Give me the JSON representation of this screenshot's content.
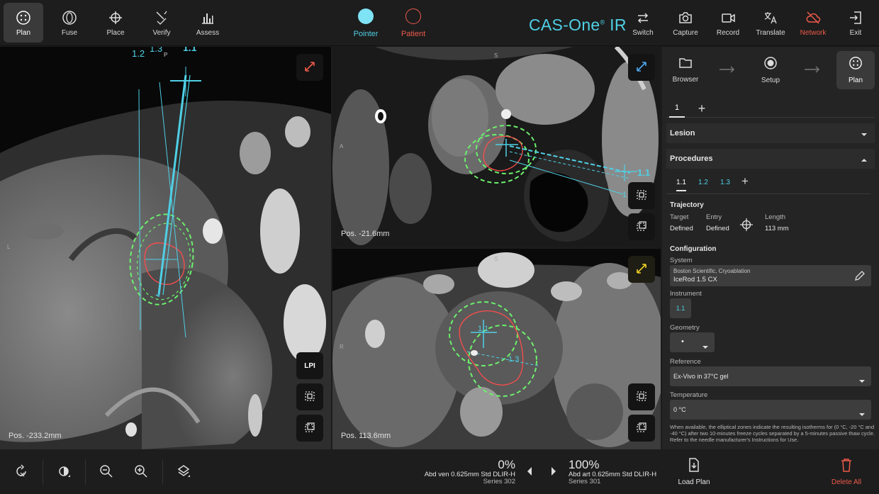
{
  "toolbar": {
    "left_tools": [
      {
        "label": "Plan",
        "icon": "plan-icon"
      },
      {
        "label": "Fuse",
        "icon": "fuse-icon"
      },
      {
        "label": "Place",
        "icon": "crosshair-icon"
      },
      {
        "label": "Verify",
        "icon": "verify-icon"
      },
      {
        "label": "Assess",
        "icon": "chart-icon"
      }
    ],
    "pointer_label": "Pointer",
    "patient_label": "Patient",
    "brand": "CAS-One",
    "brand_reg": "®",
    "brand_suffix": " IR",
    "right_tools": [
      {
        "label": "Switch",
        "icon": "switch-icon"
      },
      {
        "label": "Capture",
        "icon": "camera-icon"
      },
      {
        "label": "Record",
        "icon": "video-icon"
      },
      {
        "label": "Translate",
        "icon": "translate-icon"
      },
      {
        "label": "Network",
        "icon": "cloud-off-icon"
      },
      {
        "label": "Exit",
        "icon": "exit-icon"
      }
    ],
    "colors": {
      "accent": "#4fd0e6",
      "alert": "#ef5a4a",
      "pointer": "#6fdcf0"
    }
  },
  "viewports": {
    "left": {
      "position": "Pos. -233.2mm",
      "orientation_button": "LPI",
      "orient_marker": "L",
      "needle_labels": [
        "1.2",
        "1.3",
        "1.1",
        "P"
      ]
    },
    "top_right": {
      "position": "Pos. -21.6mm",
      "orient_top": "S",
      "orient_left": "A",
      "needle_label": "1.1",
      "needle_label_2": "1"
    },
    "bottom_right": {
      "position": "Pos. 113.6mm",
      "orient_top": "S",
      "orient_left": "R",
      "needle_label": "1.1",
      "needle_label_2": "1.3"
    }
  },
  "panel": {
    "workflow": [
      {
        "label": "Browser",
        "icon": "folder-icon"
      },
      {
        "label": "Setup",
        "icon": "setup-icon"
      },
      {
        "label": "Plan",
        "icon": "plan-icon"
      }
    ],
    "plan_tab": "1",
    "add_symbol": "+",
    "lesion_header": "Lesion",
    "procedures_header": "Procedures",
    "procedure_tabs": [
      "1.1",
      "1.2",
      "1.3"
    ],
    "trajectory": {
      "title": "Trajectory",
      "target_label": "Target",
      "target_value": "Defined",
      "entry_label": "Entry",
      "entry_value": "Defined",
      "length_label": "Length",
      "length_value": "113 mm"
    },
    "configuration": {
      "title": "Configuration",
      "system_label": "System",
      "system_line1": "Boston Scientific, Cryoablation",
      "system_line2": "IceRod 1.5 CX",
      "instrument_label": "Instrument",
      "instrument_value": "1.1",
      "geometry_label": "Geometry",
      "geometry_value": "•",
      "reference_label": "Reference",
      "reference_value": "Ex-Vivo in 37°C gel",
      "temperature_label": "Temperature",
      "temperature_value": "0 °C",
      "note": "When available, the elliptical zones indicate the resulting isotherms for (0 °C, -20 °C and -40 °C) after two 10-minutes freeze cycles separated by a 5-minutes passive thaw cycle. Refer to the needle manufacturer's Instructions for Use."
    }
  },
  "bottombar": {
    "series_left": {
      "percent": "0%",
      "line1": "Abd ven 0.625mm Std DLIR-H",
      "line2": "Series 302"
    },
    "series_right": {
      "percent": "100%",
      "line1": "Abd art 0.625mm Std DLIR-H",
      "line2": "Series 301"
    },
    "load_plan": "Load Plan",
    "delete_all": "Delete All"
  }
}
